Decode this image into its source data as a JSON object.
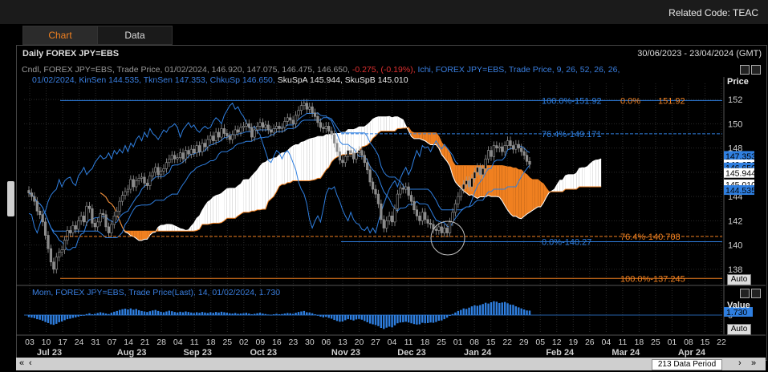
{
  "header": {
    "related_code": "Related Code: TEAC"
  },
  "tabs": [
    {
      "label": "Chart",
      "active": true
    },
    {
      "label": "Data",
      "active": false
    }
  ],
  "panel": {
    "title": "Daily FOREX JPY=EBS",
    "date_range": "30/06/2023 - 23/04/2024 (GMT)",
    "legend_line1_grey": "Cndl, FOREX JPY=EBS, Trade Price, 01/02/2024, 146.920, 147.075, 146.475, 146.650,",
    "legend_line1_red": "-0.275, (-0.19%),",
    "legend_line1_blue": "Ichi, FOREX JPY=EBS, Trade Price, 9, 26, 52, 26, 26,",
    "legend_line2_blue": "01/02/2024, KinSen 144.535, TknSen 147.353, ChkuSp 146.650,",
    "legend_line2_white": "SkuSpA 145.944, SkuSpB 145.010",
    "price_axis_title": "Price",
    "auto_label": "Auto",
    "mom_legend": "Mom, FOREX JPY=EBS, Trade Price(Last), 14, 01/02/2024, 1.730",
    "value_axis_title": "Value",
    "footer_data_period": "213 Data Period"
  },
  "chart_data": {
    "type": "candlestick",
    "price_ylim": [
      136.8,
      153.2
    ],
    "price_ticks": [
      138,
      140,
      142,
      144,
      146,
      148,
      150,
      152
    ],
    "value_ticks": [
      0
    ],
    "x_ticks": [
      "03",
      "10",
      "17",
      "24",
      "31",
      "07",
      "14",
      "21",
      "28",
      "04",
      "11",
      "18",
      "25",
      "02",
      "09",
      "16",
      "23",
      "30",
      "06",
      "13",
      "20",
      "27",
      "04",
      "11",
      "18",
      "25",
      "01",
      "08",
      "15",
      "22",
      "29",
      "05",
      "12",
      "19",
      "26",
      "04",
      "11",
      "18",
      "25",
      "01",
      "08",
      "15",
      "22"
    ],
    "x_months": [
      "Jul 23",
      "Aug 23",
      "Sep 23",
      "Oct 23",
      "Nov 23",
      "Dec 23",
      "Jan 24",
      "Feb 24",
      "Mar 24",
      "Apr 24"
    ],
    "fib_high": [
      {
        "label": "100.0%-151.92",
        "value": 151.92,
        "color": "#2f7fe0"
      },
      {
        "label": "0.0%",
        "value": 151.92,
        "color": "#f08020"
      },
      {
        "label": "151.92",
        "value": 151.92,
        "color": "#f08020"
      },
      {
        "label": "76.4%-149.171",
        "value": 149.171,
        "color": "#2f7fe0"
      },
      {
        "label": "0.0%-140.27",
        "value": 140.27,
        "color": "#2f7fe0"
      }
    ],
    "fib_low": [
      {
        "label": "76.4%-140.708",
        "value": 140.708,
        "color": "#f08020"
      },
      {
        "label": "100.0%-137.245",
        "value": 137.245,
        "color": "#f08020"
      }
    ],
    "price_labels": [
      {
        "label": "147.353",
        "value": 147.353,
        "bg": "#2f7fe0",
        "fg": "#000000"
      },
      {
        "label": "146.650",
        "value": 146.65,
        "bg": "#ffffff",
        "fg": "#000000"
      },
      {
        "label": "146.650",
        "value": 146.4,
        "bg": "#2f7fe0",
        "fg": "#000000"
      },
      {
        "label": "145.944",
        "value": 145.944,
        "bg": "#ffffff",
        "fg": "#000000"
      },
      {
        "label": "145.010",
        "value": 145.01,
        "bg": "#ffffff",
        "fg": "#000000"
      },
      {
        "label": "144.535",
        "value": 144.535,
        "bg": "#2f7fe0",
        "fg": "#000000"
      }
    ],
    "momentum_label": "1.730",
    "series": [
      {
        "name": "Cndl",
        "color": "#9a9a9a"
      },
      {
        "name": "KinSen",
        "color": "#2f7fe0"
      },
      {
        "name": "TknSen",
        "color": "#2f7fe0"
      },
      {
        "name": "ChkuSp",
        "color": "#2f7fe0"
      },
      {
        "name": "SkuSpA",
        "color": "#ffffff"
      },
      {
        "name": "SkuSpB",
        "color": "#f08020"
      }
    ],
    "closes": [
      144.3,
      144.0,
      143.6,
      142.8,
      142.5,
      141.9,
      140.8,
      139.7,
      138.6,
      138.0,
      139.0,
      139.4,
      139.6,
      140.4,
      141.2,
      141.0,
      141.6,
      141.3,
      142.0,
      142.4,
      141.9,
      143.2,
      143.0,
      141.8,
      141.5,
      141.9,
      142.6,
      142.5,
      141.5,
      141.0,
      141.7,
      142.4,
      142.8,
      143.6,
      144.1,
      144.4,
      144.6,
      145.4,
      144.8,
      145.3,
      145.5,
      145.6,
      145.1,
      144.9,
      145.7,
      146.0,
      146.4,
      145.8,
      146.1,
      146.3,
      146.8,
      147.1,
      147.4,
      147.1,
      147.2,
      147.6,
      147.1,
      147.8,
      147.5,
      147.9,
      147.6,
      148.2,
      147.7,
      148.4,
      148.1,
      148.7,
      149.0,
      148.6,
      149.3,
      148.9,
      149.6,
      149.2,
      149.0,
      148.7,
      149.1,
      149.5,
      149.3,
      149.7,
      149.8,
      150.0,
      149.7,
      148.9,
      149.5,
      149.8,
      150.1,
      149.7,
      149.9,
      149.5,
      149.3,
      149.6,
      149.8,
      149.6,
      149.7,
      150.2,
      150.5,
      150.3,
      150.0,
      150.7,
      151.1,
      151.5,
      151.7,
      151.2,
      151.4,
      150.9,
      150.6,
      150.1,
      149.7,
      149.6,
      149.8,
      149.4,
      149.1,
      148.4,
      147.7,
      147.0,
      146.8,
      147.3,
      147.8,
      147.6,
      147.1,
      147.6,
      147.8,
      147.4,
      146.8,
      146.2,
      145.2,
      144.6,
      144.2,
      143.4,
      142.1,
      141.4,
      142.0,
      142.4,
      141.9,
      143.0,
      144.2,
      144.7,
      144.6,
      144.8,
      144.1,
      143.6,
      142.9,
      142.4,
      142.0,
      142.7,
      142.1,
      141.8,
      141.7,
      141.3,
      141.2,
      141.5,
      141.0,
      141.4,
      141.0,
      141.9,
      142.7,
      143.4,
      144.0,
      144.6,
      145.0,
      145.3,
      144.8,
      145.5,
      146.0,
      146.4,
      145.8,
      146.3,
      147.1,
      147.8,
      147.3,
      148.2,
      148.0,
      148.1,
      147.7,
      148.2,
      148.6,
      148.2,
      147.9,
      148.3,
      148.0,
      147.7,
      147.4,
      146.9,
      146.65
    ],
    "momentum": [
      -0.8,
      -1.0,
      -1.2,
      -1.6,
      -1.8,
      -2.2,
      -2.7,
      -3.1,
      -3.6,
      -3.8,
      -3.4,
      -2.8,
      -2.5,
      -2.0,
      -1.6,
      -1.4,
      -1.1,
      -0.9,
      -0.6,
      -0.3,
      -0.1,
      0.4,
      0.7,
      0.3,
      0.5,
      0.8,
      1.1,
      0.9,
      0.6,
      0.4,
      0.9,
      1.3,
      1.6,
      2.0,
      2.3,
      2.5,
      2.2,
      2.6,
      2.1,
      2.4,
      1.9,
      1.6,
      1.4,
      1.2,
      1.5,
      1.8,
      2.0,
      1.6,
      1.3,
      1.1,
      1.4,
      1.7,
      1.5,
      1.2,
      1.0,
      1.3,
      1.1,
      1.4,
      1.2,
      1.0,
      0.8,
      1.1,
      0.9,
      1.2,
      1.0,
      0.8,
      1.1,
      0.9,
      1.2,
      1.0,
      1.3,
      1.1,
      0.9,
      0.7,
      0.6,
      0.8,
      0.5,
      0.6,
      0.7,
      0.9,
      0.6,
      0.3,
      0.5,
      0.7,
      0.9,
      0.6,
      0.4,
      0.2,
      0.1,
      0.3,
      0.5,
      0.3,
      0.4,
      0.6,
      0.8,
      0.7,
      0.5,
      0.9,
      1.2,
      1.4,
      1.6,
      1.1,
      1.0,
      0.7,
      0.3,
      -0.2,
      -0.6,
      -0.9,
      -0.7,
      -1.1,
      -1.4,
      -1.9,
      -2.3,
      -2.6,
      -2.5,
      -2.0,
      -1.6,
      -1.8,
      -2.1,
      -1.7,
      -1.5,
      -1.8,
      -2.3,
      -2.8,
      -3.3,
      -3.6,
      -3.9,
      -4.3,
      -5.0,
      -5.4,
      -4.9,
      -4.5,
      -4.8,
      -4.0,
      -3.2,
      -2.9,
      -2.8,
      -2.6,
      -2.9,
      -3.2,
      -3.5,
      -3.7,
      -3.6,
      -3.0,
      -3.2,
      -3.1,
      -2.9,
      -3.0,
      -2.7,
      -2.2,
      -2.1,
      -1.6,
      -1.0,
      -0.3,
      0.4,
      1.0,
      1.6,
      2.0,
      2.6,
      2.4,
      2.9,
      3.4,
      3.8,
      3.6,
      3.9,
      4.3,
      4.8,
      4.5,
      5.0,
      5.4,
      5.2,
      4.7,
      4.9,
      5.1,
      4.6,
      4.1,
      4.0,
      3.4,
      3.0,
      2.6,
      2.2,
      1.8,
      1.73
    ]
  }
}
